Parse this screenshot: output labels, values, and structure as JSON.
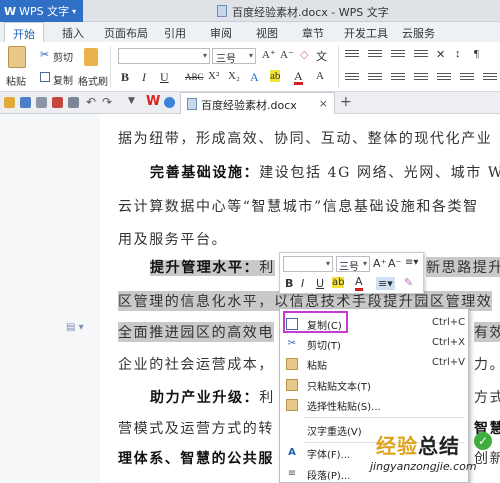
{
  "titlebar": {
    "app_label": "WPS 文字",
    "title": "百度经验素材.docx - WPS 文字"
  },
  "menu": {
    "tabs": [
      "开始",
      "插入",
      "页面布局",
      "引用",
      "审阅",
      "视图",
      "章节",
      "开发工具",
      "云服务"
    ]
  },
  "ribbon": {
    "paste": "粘贴",
    "cut": "剪切",
    "copy": "复制",
    "format_painter": "格式刷",
    "font_size": "三号",
    "bold": "B",
    "italic": "I",
    "underline": "U",
    "strike": "ABC",
    "superscript": "X²",
    "subscript": "X₂",
    "text_effect": "A",
    "highlight": "ab",
    "font_color": "A"
  },
  "doc_tab": {
    "name": "百度经验素材.docx",
    "close": "×",
    "new": "+"
  },
  "document": {
    "lines": [
      "据为纽带，形成高效、协同、互动、整体的现代化产业",
      "完善基础设施：",
      "建设包括 4G 网络、光网、城市 W",
      "云计算数据中心等“智慧城市”信息基础设施和各类智",
      "用及服务平台。",
      "提升管理水平：",
      "利",
      "新思路提升",
      "区管理的信息化水平，以信息技术手段提升园区管理效",
      "全面推进园区的高效电",
      "有效",
      "企业的社会运营成本，",
      "力。",
      "助力产业升级：",
      "利",
      "方式",
      "营模式及运营方式的转",
      "智慧",
      "理体系、智慧的公共服",
      "创新"
    ]
  },
  "mini_toolbar": {
    "font_size": "三号",
    "grow": "A⁺",
    "shrink": "A⁻",
    "bold": "B",
    "italic": "I",
    "underline": "U",
    "highlight": "ab",
    "font_color": "A"
  },
  "context_menu": {
    "items": [
      {
        "label": "复制(C)",
        "shortcut": "Ctrl+C",
        "icon": "copy-icon"
      },
      {
        "label": "剪切(T)",
        "shortcut": "Ctrl+X",
        "icon": "cut-icon"
      },
      {
        "label": "粘贴",
        "shortcut": "Ctrl+V",
        "icon": "paste-icon"
      },
      {
        "label": "只粘贴文本(T)",
        "shortcut": "",
        "icon": "paste-text-icon"
      },
      {
        "label": "选择性粘贴(S)...",
        "shortcut": "",
        "icon": "paste-special-icon"
      },
      {
        "label": "汉字重选(V)",
        "shortcut": "",
        "icon": ""
      },
      {
        "label": "字体(F)...",
        "shortcut": "",
        "icon": "font-icon"
      },
      {
        "label": "段落(P)...",
        "shortcut": "",
        "icon": "paragraph-icon"
      }
    ]
  },
  "watermark": {
    "title_a": "经验",
    "title_b": "总结",
    "url": "jingyanzongjie.com"
  },
  "colors": {
    "accent": "#2f6fc6",
    "highlight_border": "#c73bd1",
    "selection": "#c9c9c9"
  }
}
